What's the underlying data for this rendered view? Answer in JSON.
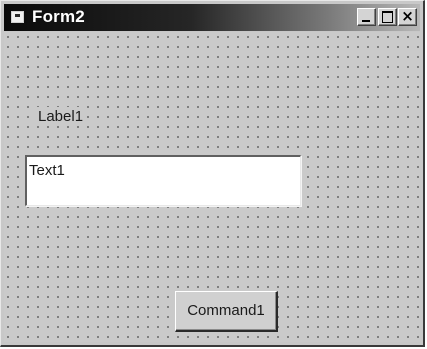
{
  "window": {
    "title": "Form2"
  },
  "titlebar_buttons": {
    "minimize_icon": "minimize-icon",
    "maximize_icon": "maximize-icon",
    "close_icon": "close-icon",
    "close_glyph": "×"
  },
  "form": {
    "label": "Label1",
    "textbox_value": "Text1",
    "command_label": "Command1"
  },
  "colors": {
    "titlebar_start": "#0a0a0a",
    "titlebar_end": "#b8b8b8",
    "form_background": "#cacaca",
    "grid_dot": "#6a6a6a"
  }
}
